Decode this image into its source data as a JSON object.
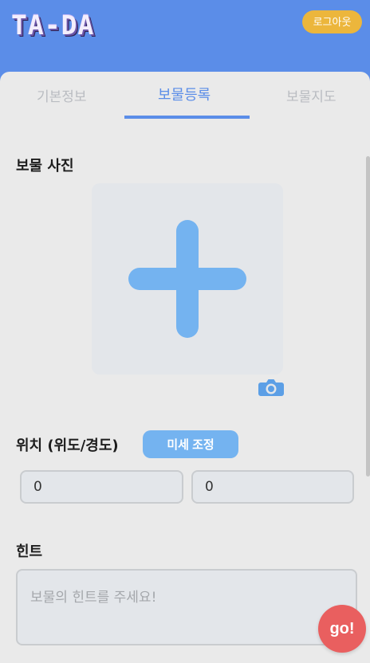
{
  "header": {
    "logo_text": "TA-DA",
    "logout_label": "로그아웃"
  },
  "tabs": [
    {
      "label": "기본정보",
      "active": false
    },
    {
      "label": "보물등록",
      "active": true
    },
    {
      "label": "보물지도",
      "active": false
    }
  ],
  "form": {
    "photo_label": "보물 사진",
    "location_label": "위치 (위도/경도)",
    "fine_tune_label": "미세 조정",
    "latitude_value": "0",
    "longitude_value": "0",
    "hint_label": "힌트",
    "hint_placeholder": "보물의 힌트를 주세요!"
  },
  "go_button_label": "go!",
  "colors": {
    "header": "#5b8de8",
    "accent": "#5b8de8",
    "logout": "#ecb63c",
    "plus": "#74b3f0",
    "go": "#e95f5f"
  },
  "icons": {
    "add_photo": "plus-icon",
    "camera": "camera-icon"
  }
}
